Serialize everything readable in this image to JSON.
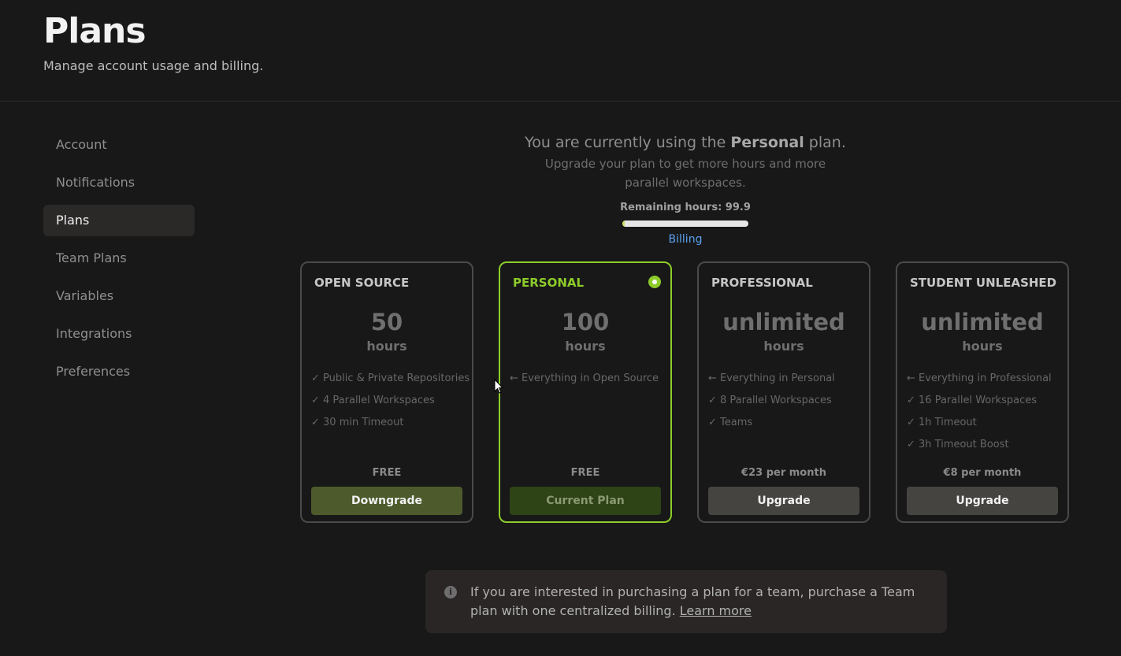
{
  "header": {
    "title": "Plans",
    "subtitle": "Manage account usage and billing."
  },
  "sidebar": {
    "items": [
      {
        "label": "Account"
      },
      {
        "label": "Notifications"
      },
      {
        "label": "Plans",
        "active": true
      },
      {
        "label": "Team Plans"
      },
      {
        "label": "Variables"
      },
      {
        "label": "Integrations"
      },
      {
        "label": "Preferences"
      }
    ]
  },
  "summary": {
    "prefix": "You are currently using the ",
    "plan_name": "Personal",
    "suffix": " plan.",
    "subtext": "Upgrade your plan to get more hours and more parallel workspaces.",
    "remaining_label": "Remaining hours: 99.9",
    "remaining_hours": 99.9,
    "total_hours": 100,
    "progress_fraction": 0.001,
    "billing_link": "Billing"
  },
  "plans": [
    {
      "title": "OPEN SOURCE",
      "amount": "50",
      "unit": "hours",
      "features": [
        "✓ Public & Private Repositories",
        "✓ 4 Parallel Workspaces",
        "✓ 30 min Timeout"
      ],
      "price": "FREE",
      "button": "Downgrade",
      "selected": false
    },
    {
      "title": "PERSONAL",
      "amount": "100",
      "unit": "hours",
      "features": [
        "← Everything in Open Source"
      ],
      "price": "FREE",
      "button": "Current Plan",
      "selected": true
    },
    {
      "title": "PROFESSIONAL",
      "amount": "unlimited",
      "unit": "hours",
      "features": [
        "← Everything in Personal",
        "✓ 8 Parallel Workspaces",
        "✓ Teams"
      ],
      "price": "€23 per month",
      "button": "Upgrade",
      "selected": false
    },
    {
      "title": "STUDENT UNLEASHED",
      "amount": "unlimited",
      "unit": "hours",
      "features": [
        "← Everything in Professional",
        "✓ 16 Parallel Workspaces",
        "✓ 1h Timeout",
        "✓ 3h Timeout Boost"
      ],
      "price": "€8 per month",
      "button": "Upgrade",
      "selected": false
    }
  ],
  "info": {
    "icon": "info-icon",
    "text": "If you are interested in purchasing a plan for a team, purchase a Team plan with one centralized billing. ",
    "link": "Learn more"
  },
  "colors": {
    "accent": "#8dcc2a",
    "background": "#181818",
    "link": "#5aa0f0"
  }
}
